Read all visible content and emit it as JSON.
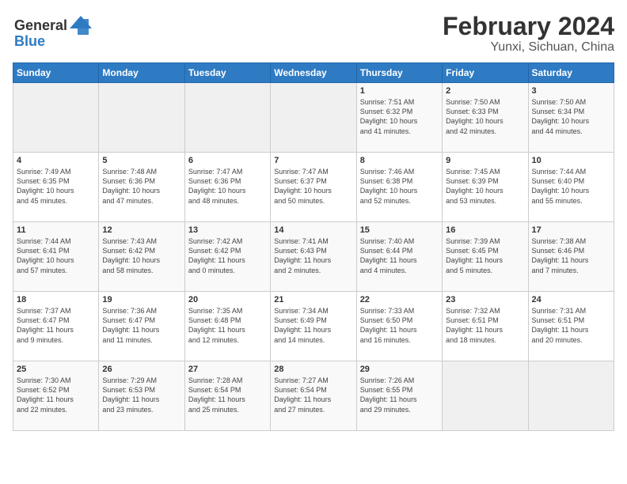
{
  "logo": {
    "line1": "General",
    "line2": "Blue"
  },
  "title": "February 2024",
  "subtitle": "Yunxi, Sichuan, China",
  "days_of_week": [
    "Sunday",
    "Monday",
    "Tuesday",
    "Wednesday",
    "Thursday",
    "Friday",
    "Saturday"
  ],
  "weeks": [
    [
      {
        "day": "",
        "info": ""
      },
      {
        "day": "",
        "info": ""
      },
      {
        "day": "",
        "info": ""
      },
      {
        "day": "",
        "info": ""
      },
      {
        "day": "1",
        "info": "Sunrise: 7:51 AM\nSunset: 6:32 PM\nDaylight: 10 hours\nand 41 minutes."
      },
      {
        "day": "2",
        "info": "Sunrise: 7:50 AM\nSunset: 6:33 PM\nDaylight: 10 hours\nand 42 minutes."
      },
      {
        "day": "3",
        "info": "Sunrise: 7:50 AM\nSunset: 6:34 PM\nDaylight: 10 hours\nand 44 minutes."
      }
    ],
    [
      {
        "day": "4",
        "info": "Sunrise: 7:49 AM\nSunset: 6:35 PM\nDaylight: 10 hours\nand 45 minutes."
      },
      {
        "day": "5",
        "info": "Sunrise: 7:48 AM\nSunset: 6:36 PM\nDaylight: 10 hours\nand 47 minutes."
      },
      {
        "day": "6",
        "info": "Sunrise: 7:47 AM\nSunset: 6:36 PM\nDaylight: 10 hours\nand 48 minutes."
      },
      {
        "day": "7",
        "info": "Sunrise: 7:47 AM\nSunset: 6:37 PM\nDaylight: 10 hours\nand 50 minutes."
      },
      {
        "day": "8",
        "info": "Sunrise: 7:46 AM\nSunset: 6:38 PM\nDaylight: 10 hours\nand 52 minutes."
      },
      {
        "day": "9",
        "info": "Sunrise: 7:45 AM\nSunset: 6:39 PM\nDaylight: 10 hours\nand 53 minutes."
      },
      {
        "day": "10",
        "info": "Sunrise: 7:44 AM\nSunset: 6:40 PM\nDaylight: 10 hours\nand 55 minutes."
      }
    ],
    [
      {
        "day": "11",
        "info": "Sunrise: 7:44 AM\nSunset: 6:41 PM\nDaylight: 10 hours\nand 57 minutes."
      },
      {
        "day": "12",
        "info": "Sunrise: 7:43 AM\nSunset: 6:42 PM\nDaylight: 10 hours\nand 58 minutes."
      },
      {
        "day": "13",
        "info": "Sunrise: 7:42 AM\nSunset: 6:42 PM\nDaylight: 11 hours\nand 0 minutes."
      },
      {
        "day": "14",
        "info": "Sunrise: 7:41 AM\nSunset: 6:43 PM\nDaylight: 11 hours\nand 2 minutes."
      },
      {
        "day": "15",
        "info": "Sunrise: 7:40 AM\nSunset: 6:44 PM\nDaylight: 11 hours\nand 4 minutes."
      },
      {
        "day": "16",
        "info": "Sunrise: 7:39 AM\nSunset: 6:45 PM\nDaylight: 11 hours\nand 5 minutes."
      },
      {
        "day": "17",
        "info": "Sunrise: 7:38 AM\nSunset: 6:46 PM\nDaylight: 11 hours\nand 7 minutes."
      }
    ],
    [
      {
        "day": "18",
        "info": "Sunrise: 7:37 AM\nSunset: 6:47 PM\nDaylight: 11 hours\nand 9 minutes."
      },
      {
        "day": "19",
        "info": "Sunrise: 7:36 AM\nSunset: 6:47 PM\nDaylight: 11 hours\nand 11 minutes."
      },
      {
        "day": "20",
        "info": "Sunrise: 7:35 AM\nSunset: 6:48 PM\nDaylight: 11 hours\nand 12 minutes."
      },
      {
        "day": "21",
        "info": "Sunrise: 7:34 AM\nSunset: 6:49 PM\nDaylight: 11 hours\nand 14 minutes."
      },
      {
        "day": "22",
        "info": "Sunrise: 7:33 AM\nSunset: 6:50 PM\nDaylight: 11 hours\nand 16 minutes."
      },
      {
        "day": "23",
        "info": "Sunrise: 7:32 AM\nSunset: 6:51 PM\nDaylight: 11 hours\nand 18 minutes."
      },
      {
        "day": "24",
        "info": "Sunrise: 7:31 AM\nSunset: 6:51 PM\nDaylight: 11 hours\nand 20 minutes."
      }
    ],
    [
      {
        "day": "25",
        "info": "Sunrise: 7:30 AM\nSunset: 6:52 PM\nDaylight: 11 hours\nand 22 minutes."
      },
      {
        "day": "26",
        "info": "Sunrise: 7:29 AM\nSunset: 6:53 PM\nDaylight: 11 hours\nand 23 minutes."
      },
      {
        "day": "27",
        "info": "Sunrise: 7:28 AM\nSunset: 6:54 PM\nDaylight: 11 hours\nand 25 minutes."
      },
      {
        "day": "28",
        "info": "Sunrise: 7:27 AM\nSunset: 6:54 PM\nDaylight: 11 hours\nand 27 minutes."
      },
      {
        "day": "29",
        "info": "Sunrise: 7:26 AM\nSunset: 6:55 PM\nDaylight: 11 hours\nand 29 minutes."
      },
      {
        "day": "",
        "info": ""
      },
      {
        "day": "",
        "info": ""
      }
    ]
  ]
}
